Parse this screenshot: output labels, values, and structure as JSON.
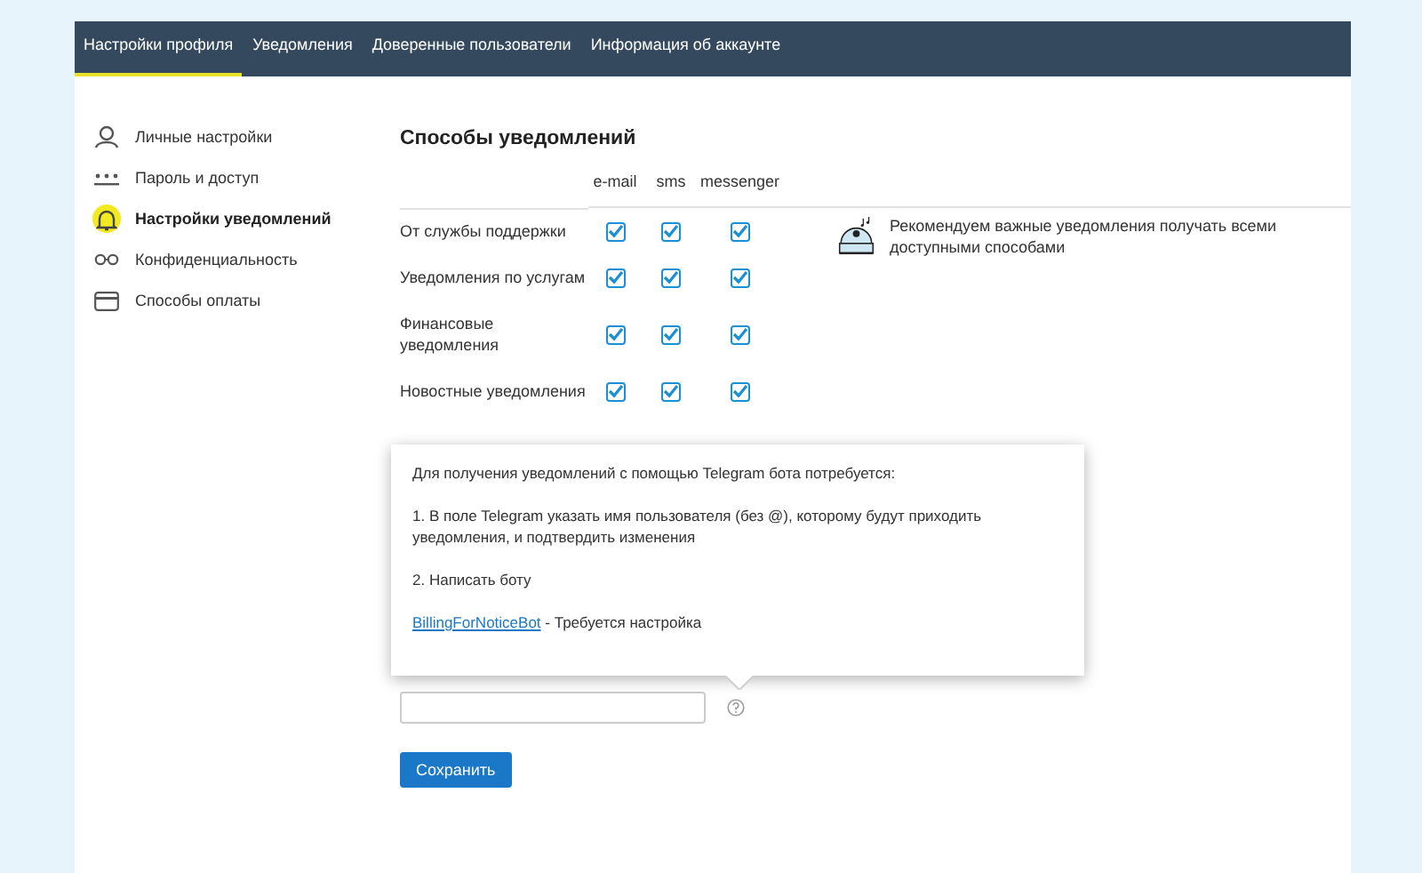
{
  "nav": {
    "tabs": [
      {
        "label": "Настройки профиля",
        "selected": true
      },
      {
        "label": "Уведомления",
        "selected": false
      },
      {
        "label": "Доверенные пользователи",
        "selected": false
      },
      {
        "label": "Информация об аккаунте",
        "selected": false
      }
    ]
  },
  "sidebar": {
    "items": [
      {
        "label": "Личные настройки",
        "selected": false
      },
      {
        "label": "Пароль и доступ",
        "selected": false
      },
      {
        "label": "Настройки уведомлений",
        "selected": true
      },
      {
        "label": "Конфиденциальность",
        "selected": false
      },
      {
        "label": "Способы оплаты",
        "selected": false
      }
    ]
  },
  "heading": "Способы уведомлений",
  "table": {
    "columns": [
      "e-mail",
      "sms",
      "messenger"
    ],
    "rows": [
      {
        "label": "От службы поддержки",
        "checks": [
          true,
          true,
          true
        ]
      },
      {
        "label": "Уведомления по услугам",
        "checks": [
          true,
          true,
          true
        ]
      },
      {
        "label": "Финансовые уведомления",
        "checks": [
          true,
          true,
          true
        ]
      },
      {
        "label": "Новостные уведомления",
        "checks": [
          true,
          true,
          true
        ]
      }
    ]
  },
  "hint": "Рекомендуем важные уведомления получать всеми доступными способами",
  "tooltip": {
    "title": "Для получения уведомлений с помощью Telegram бота потребуется:",
    "step_1": "1. В поле Telegram указать имя пользователя (без @), которому будут приходить уведомления, и подтвердить изменения",
    "step_2": "2. Написать боту",
    "bot_link": "BillingForNoticeBot",
    "bot_status": "- Требуется настройка"
  },
  "save_button": "Сохранить"
}
